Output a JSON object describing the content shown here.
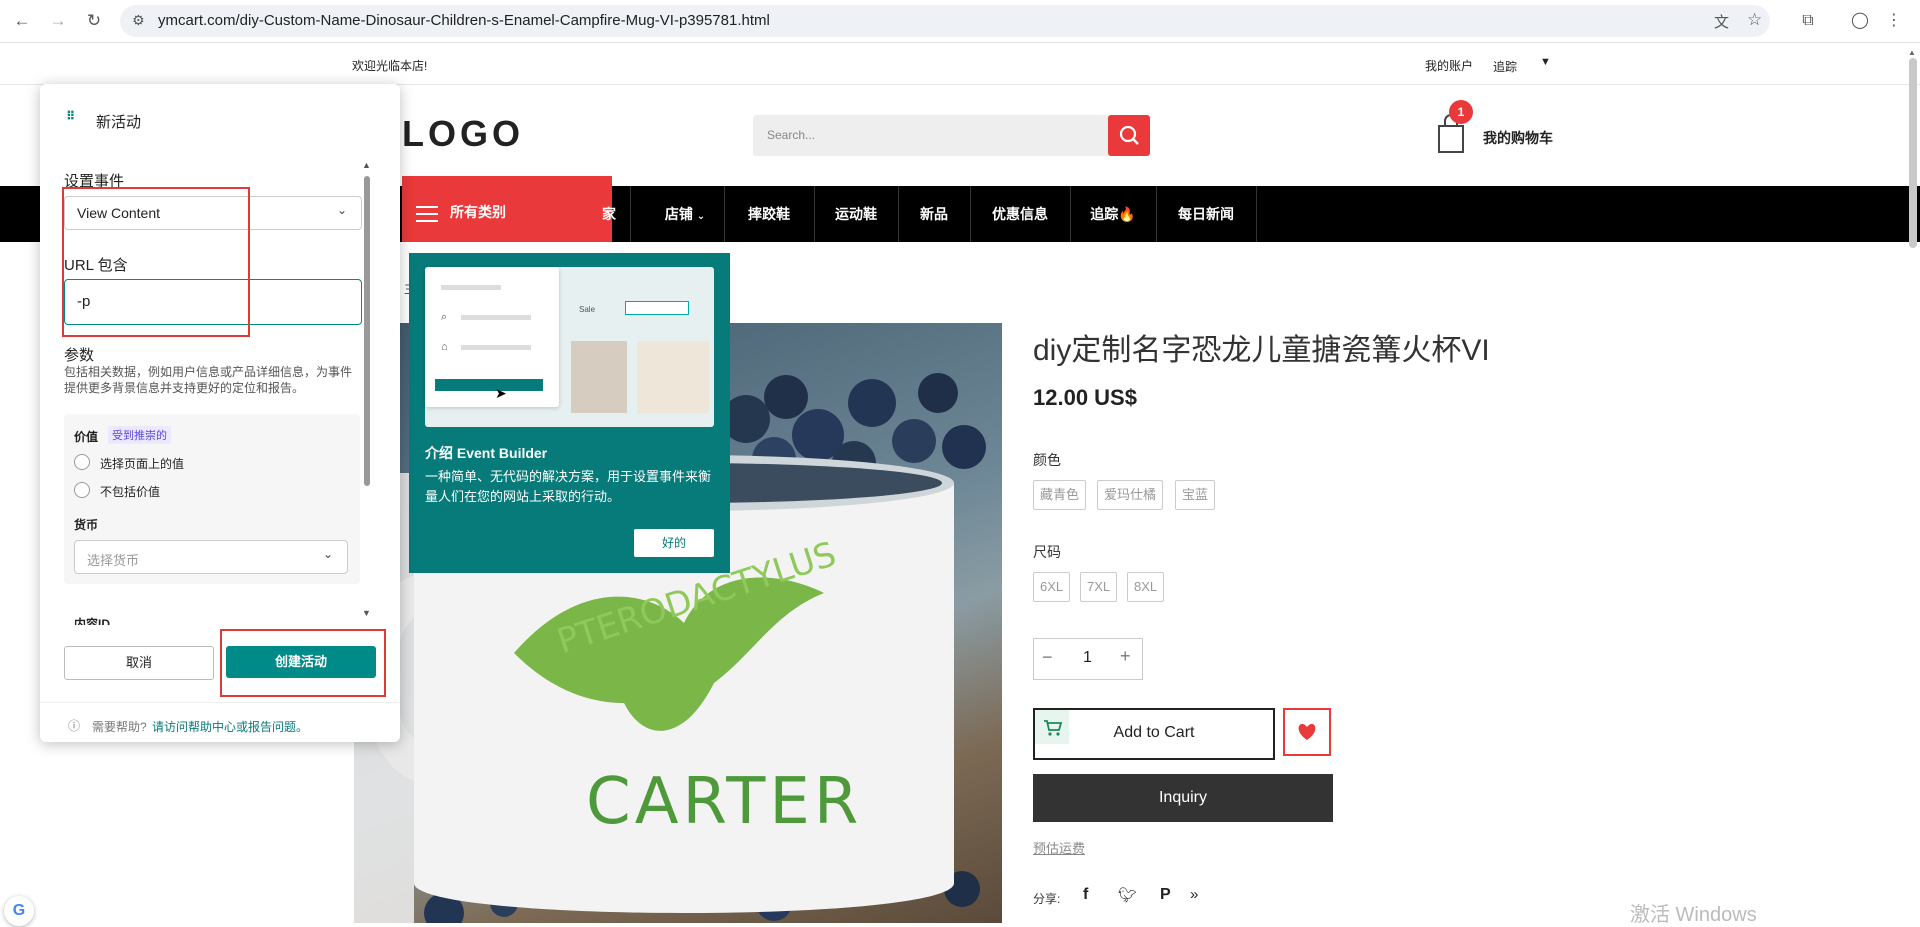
{
  "browser": {
    "url": "ymcart.com/diy-Custom-Name-Dinosaur-Children-s-Enamel-Campfire-Mug-VI-p395781.html"
  },
  "topbar": {
    "welcome": "欢迎光临本店!",
    "account": "我的账户",
    "track": "追踪"
  },
  "header": {
    "logo": "LOGO",
    "search_placeholder": "Search...",
    "cart_count": "1",
    "cart_label": "我的购物车"
  },
  "nav": {
    "categories": "所有类别",
    "items": [
      "家",
      "店铺",
      "摔跤鞋",
      "运动鞋",
      "新品",
      "优惠信息",
      "追踪🔥",
      "每日新闻"
    ]
  },
  "product": {
    "title": "diy定制名字恐龙儿童搪瓷篝火杯VI",
    "price": "12.00 US$",
    "color_label": "颜色",
    "colors": [
      "藏青色",
      "爱玛仕橘",
      "宝蓝"
    ],
    "size_label": "尺码",
    "sizes": [
      "6XL",
      "7XL",
      "8XL"
    ],
    "qty": "1",
    "add_to_cart": "Add to Cart",
    "inquiry": "Inquiry",
    "shipping": "预估运费",
    "share": "分享:",
    "mug_text_arc": "PTERODACTYLUS",
    "mug_name": "CARTER",
    "breadcrumb_fragment": "主"
  },
  "panel": {
    "title": "新活动",
    "event_label": "设置事件",
    "event_value": "View Content",
    "url_label": "URL 包含",
    "url_value": "-p",
    "params_title": "参数",
    "params_desc": "包括相关数据，例如用户信息或产品详细信息，为事件提供更多背景信息并支持更好的定位和报告。",
    "value_label": "价值",
    "recommended": "受到推崇的",
    "radio1": "选择页面上的值",
    "radio2": "不包括价值",
    "currency_label": "货币",
    "currency_placeholder": "选择货币",
    "content_id": "内容ID",
    "cancel": "取消",
    "create": "创建活动",
    "help_prefix": "需要帮助?",
    "help_link": "请访问帮助中心或报告问题。"
  },
  "popover": {
    "mock_sale": "Sale",
    "title": "介绍 Event Builder",
    "desc": "一种简单、无代码的解决方案，用于设置事件来衡量人们在您的网站上采取的行动。",
    "ok": "好的"
  },
  "watermark": "激活 Windows",
  "colors": {
    "accent_red": "#e9393a",
    "teal": "#008a88",
    "popover_bg": "#067b7a"
  }
}
